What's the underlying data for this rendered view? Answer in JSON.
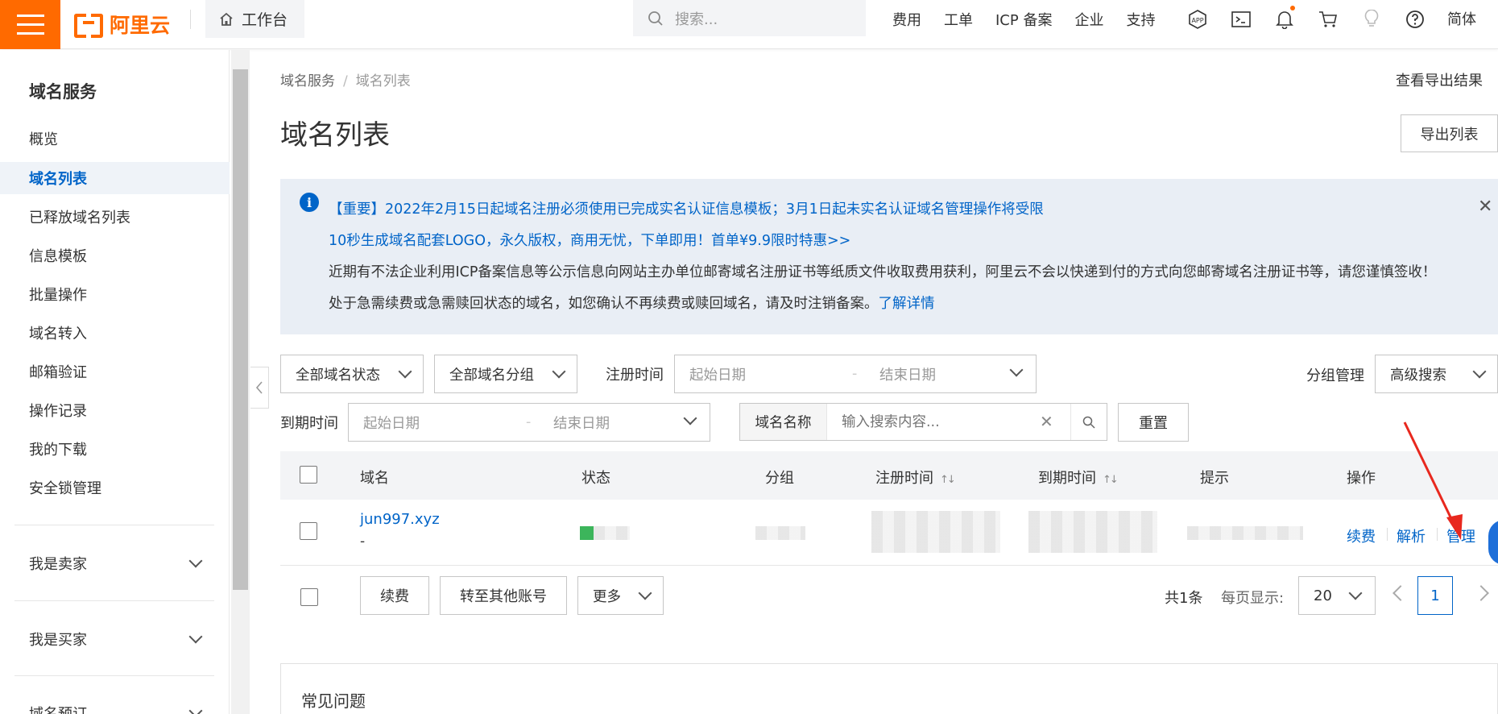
{
  "header": {
    "logo_text": "阿里云",
    "workbench": "工作台",
    "search_placeholder": "搜索...",
    "links": [
      "费用",
      "工单",
      "ICP 备案",
      "企业",
      "支持"
    ],
    "language": "简体",
    "brand_color": "#ff6a00"
  },
  "sidebar": {
    "title": "域名服务",
    "items": [
      {
        "label": "概览"
      },
      {
        "label": "域名列表",
        "active": true
      },
      {
        "label": "已释放域名列表"
      },
      {
        "label": "信息模板"
      },
      {
        "label": "批量操作"
      },
      {
        "label": "域名转入"
      },
      {
        "label": "邮箱验证"
      },
      {
        "label": "操作记录"
      },
      {
        "label": "我的下载"
      },
      {
        "label": "安全锁管理"
      }
    ],
    "groups": [
      {
        "label": "我是卖家"
      },
      {
        "label": "我是买家"
      },
      {
        "label": "域名预订"
      }
    ]
  },
  "breadcrumb": {
    "parent": "域名服务",
    "current": "域名列表"
  },
  "page": {
    "title": "域名列表",
    "export_result_link": "查看导出结果",
    "export_button": "导出列表"
  },
  "notice": {
    "line1": "【重要】2022年2月15日起域名注册必须使用已完成实名认证信息模板；3月1日起未实名认证域名管理操作将受限",
    "line2": "10秒生成域名配套LOGO，永久版权，商用无忧，下单即用！首单¥9.9限时特惠>>",
    "line3": "近期有不法企业利用ICP备案信息等公示信息向网站主办单位邮寄域名注册证书等纸质文件收取费用获利，阿里云不会以快递到付的方式向您邮寄域名注册证书等，请您谨慎签收！",
    "line4_text": "处于急需续费或急需赎回状态的域名，如您确认不再续费或赎回域名，请及时注销备案。",
    "line4_link": "了解详情"
  },
  "filters": {
    "status_select": "全部域名状态",
    "group_select": "全部域名分组",
    "reg_time_label": "注册时间",
    "start_date": "起始日期",
    "end_date": "结束日期",
    "group_manage": "分组管理",
    "advanced_search": "高级搜索",
    "expire_time_label": "到期时间",
    "search_field_label": "域名名称",
    "search_placeholder": "输入搜索内容...",
    "reset": "重置"
  },
  "table": {
    "columns": [
      "域名",
      "状态",
      "分组",
      "注册时间",
      "到期时间",
      "提示",
      "操作"
    ],
    "rows": [
      {
        "domain": "jun997.xyz",
        "sub": "-",
        "actions": [
          "续费",
          "解析",
          "管理"
        ]
      }
    ]
  },
  "bulk": {
    "renew": "续费",
    "transfer": "转至其他账号",
    "more": "更多",
    "total": "共1条",
    "per_page_label": "每页显示:",
    "page_size": "20",
    "current_page": "1"
  },
  "faq": {
    "title": "常见问题"
  }
}
